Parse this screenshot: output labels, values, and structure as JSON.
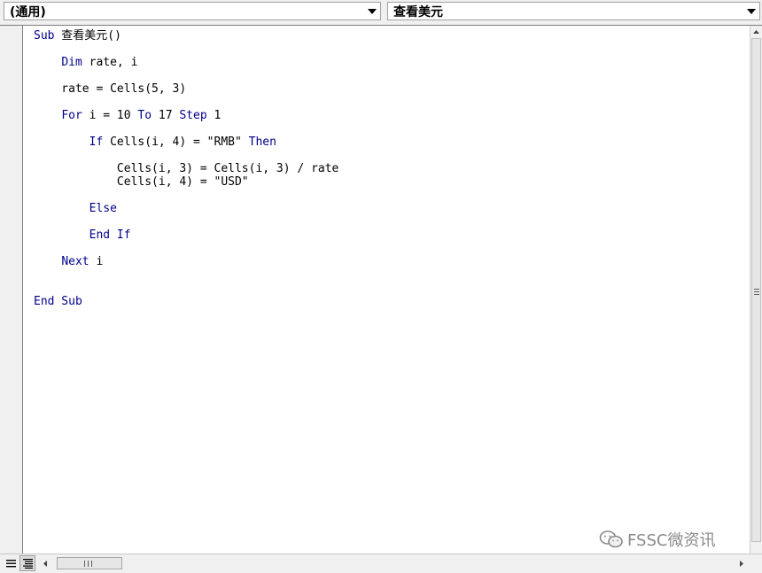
{
  "toolbar": {
    "object_combo": "(通用)",
    "procedure_combo": "查看美元"
  },
  "code": {
    "lines": [
      {
        "parts": [
          {
            "t": "kw",
            "v": "Sub"
          },
          {
            "t": "tx",
            "v": " 查看美元()"
          }
        ]
      },
      {
        "parts": [
          {
            "t": "tx",
            "v": "    "
          },
          {
            "t": "kw",
            "v": "Dim"
          },
          {
            "t": "tx",
            "v": " rate, i"
          }
        ]
      },
      {
        "parts": [
          {
            "t": "tx",
            "v": "    rate = Cells(5, 3)"
          }
        ]
      },
      {
        "parts": [
          {
            "t": "tx",
            "v": "    "
          },
          {
            "t": "kw",
            "v": "For"
          },
          {
            "t": "tx",
            "v": " i = 10 "
          },
          {
            "t": "kw",
            "v": "To"
          },
          {
            "t": "tx",
            "v": " 17 "
          },
          {
            "t": "kw",
            "v": "Step"
          },
          {
            "t": "tx",
            "v": " 1"
          }
        ]
      },
      {
        "parts": [
          {
            "t": "tx",
            "v": "        "
          },
          {
            "t": "kw",
            "v": "If"
          },
          {
            "t": "tx",
            "v": " Cells(i, 4) = \"RMB\" "
          },
          {
            "t": "kw",
            "v": "Then"
          }
        ]
      },
      {
        "parts": [
          {
            "t": "tx",
            "v": "            Cells(i, 3) = Cells(i, 3) / rate"
          }
        ]
      },
      {
        "parts": [
          {
            "t": "tx",
            "v": "            Cells(i, 4) = \"USD\""
          }
        ]
      },
      {
        "parts": [
          {
            "t": "tx",
            "v": "        "
          },
          {
            "t": "kw",
            "v": "Else"
          }
        ]
      },
      {
        "parts": [
          {
            "t": "tx",
            "v": "        "
          },
          {
            "t": "kw",
            "v": "End If"
          }
        ]
      },
      {
        "parts": [
          {
            "t": "tx",
            "v": "    "
          },
          {
            "t": "kw",
            "v": "Next"
          },
          {
            "t": "tx",
            "v": " i"
          }
        ]
      },
      {
        "parts": [
          {
            "t": "kw",
            "v": "End Sub"
          }
        ]
      }
    ]
  },
  "watermark": {
    "text": "FSSC微资讯"
  },
  "icons": {
    "combo_arrow": "chevron-down-icon",
    "procedure_view": "procedure-view-icon",
    "full_module_view": "full-module-view-icon",
    "watermark_logo": "wechat-logo-icon"
  },
  "colors": {
    "keyword": "#00008b",
    "text": "#000000",
    "watermark": "#8a8a8a"
  }
}
